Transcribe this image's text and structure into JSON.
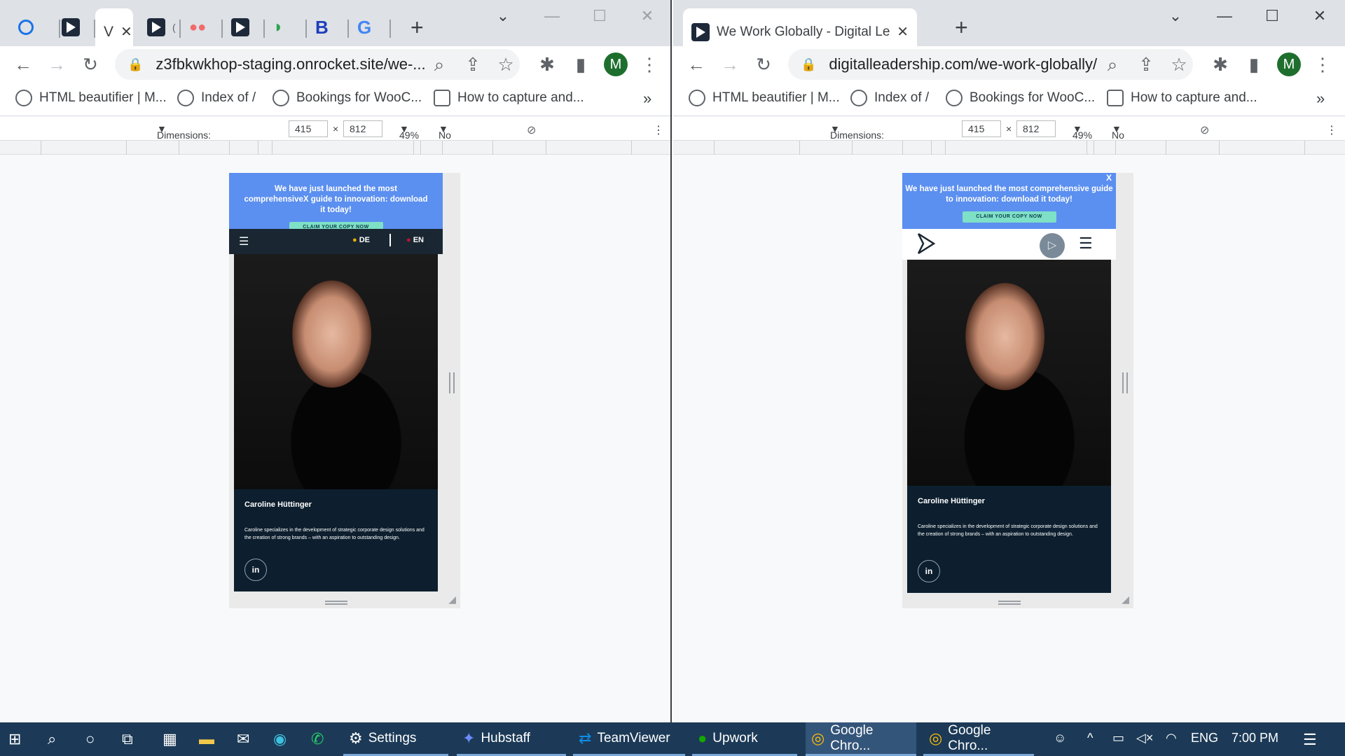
{
  "left_window": {
    "tabs": [
      {
        "icon": "history-icon",
        "label": ""
      },
      {
        "icon": "dl-logo-icon",
        "label": ""
      },
      {
        "icon": "dl-logo-icon",
        "label": "V",
        "active": true
      },
      {
        "icon": "dl-logo-icon",
        "label": "("
      },
      {
        "icon": "asana-icon",
        "label": ""
      },
      {
        "icon": "dl-logo-icon",
        "label": ""
      },
      {
        "icon": "leaf-icon",
        "label": ""
      },
      {
        "icon": "b-icon",
        "label": "B"
      },
      {
        "icon": "google-icon",
        "label": "G"
      }
    ],
    "url": "z3fbkwkhop-staging.onrocket.site/we-...",
    "devtools": {
      "dimensions_label": "Dimensions: Responsive",
      "width": "415",
      "times": "×",
      "height": "812",
      "zoom": "49%",
      "throttling": "No throttling"
    },
    "page": {
      "banner_text": "We have just launched the most comprehensiveX guide to innovation: download it today!",
      "banner_cta": "CLAIM YOUR COPY NOW",
      "lang_de": "DE",
      "lang_en": "EN",
      "person_name": "Caroline Hüttinger",
      "person_desc": "Caroline specializes in the development of strategic corporate design solutions and the creation of strong brands – with an aspiration to outstanding design.",
      "linkedin": "in"
    }
  },
  "right_window": {
    "tabs": [
      {
        "icon": "dl-logo-icon",
        "label": "We Work Globally - Digital Leade",
        "active": true
      }
    ],
    "url": "digitalleadership.com/we-work-globally/",
    "devtools": {
      "dimensions_label": "Dimensions: Responsive",
      "width": "415",
      "times": "×",
      "height": "812",
      "zoom": "49%",
      "throttling": "No throttling"
    },
    "page": {
      "banner_text": "We have just launched the most comprehensive guide to innovation: download it today!",
      "banner_cta": "CLAIM YOUR COPY NOW",
      "banner_close": "X",
      "person_name": "Caroline Hüttinger",
      "person_desc": "Caroline specializes in the development of strategic corporate design solutions and the creation of strong brands – with an aspiration to outstanding design.",
      "linkedin": "in"
    }
  },
  "bookmarks": [
    {
      "icon": "wordpress-icon",
      "label": "HTML beautifier | M..."
    },
    {
      "icon": "globe-icon",
      "label": "Index of /"
    },
    {
      "icon": "wordpress-icon",
      "label": "Bookings for WooC..."
    },
    {
      "icon": "panda-icon",
      "label": "How to capture and..."
    }
  ],
  "bookmarks_more": "»",
  "avatar_letter": "M",
  "window_controls": {
    "dropdown": "⌄",
    "minimize": "—",
    "maximize": "☐",
    "close": "✕"
  },
  "taskbar": {
    "apps": [
      {
        "icon": "settings-icon",
        "label": "Settings"
      },
      {
        "icon": "hubstaff-icon",
        "label": "Hubstaff"
      },
      {
        "icon": "teamviewer-icon",
        "label": "TeamViewer"
      },
      {
        "icon": "upwork-icon",
        "label": "Upwork"
      },
      {
        "icon": "chrome-icon",
        "label": "Google Chro...",
        "active": true
      },
      {
        "icon": "chrome-icon",
        "label": "Google Chro..."
      }
    ],
    "lang": "ENG",
    "time": "7:00 PM"
  },
  "colors": {
    "banner": "#5b8ff0",
    "cta": "#7ee0c6",
    "card_bg": "#0d1f2e",
    "taskbar": "#1c3a57"
  }
}
